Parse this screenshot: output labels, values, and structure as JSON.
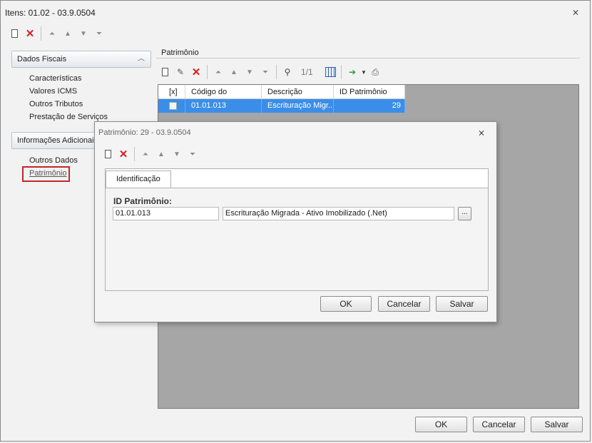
{
  "window": {
    "title": "Itens: 01.02 - 03.9.0504",
    "close_glyph": "⨯"
  },
  "sidebar": {
    "groups": [
      {
        "label": "Dados Fiscais",
        "chevron": "︿",
        "items": [
          "Características",
          "Valores ICMS",
          "Outros Tributos",
          "Prestação de Serviços"
        ]
      },
      {
        "label": "Informações Adicionais",
        "items": [
          "Outros Dados",
          "Patrimônio"
        ]
      }
    ]
  },
  "patrimonio_panel": {
    "title": "Patrimônio",
    "record_counter": "1/1",
    "grid": {
      "columns": [
        "[x]",
        "Código do",
        "Descrição",
        "ID Patrimônio"
      ],
      "rows": [
        {
          "checked": false,
          "codigo": "01.01.013",
          "descricao": "Escrituração Migr...",
          "id_patrimonio": "29"
        }
      ]
    }
  },
  "dialog": {
    "title": "Patrimônio: 29 - 03.9.0504",
    "close_glyph": "⨯",
    "tab_label": "Identificação",
    "field_label": "ID Patrimônio:",
    "field_code": "01.01.013",
    "field_description": "Escrituração Migrada - Ativo Imobilizado (.Net)",
    "lookup_label": "...",
    "buttons": {
      "ok": "OK",
      "cancel": "Cancelar",
      "save": "Salvar"
    }
  },
  "footer_buttons": {
    "ok": "OK",
    "cancel": "Cancelar",
    "save": "Salvar"
  },
  "colors": {
    "selection": "#3b8ee8",
    "highlight_border": "#c0282d",
    "grid_background": "#a6a6a6",
    "delete": "#d62020"
  }
}
